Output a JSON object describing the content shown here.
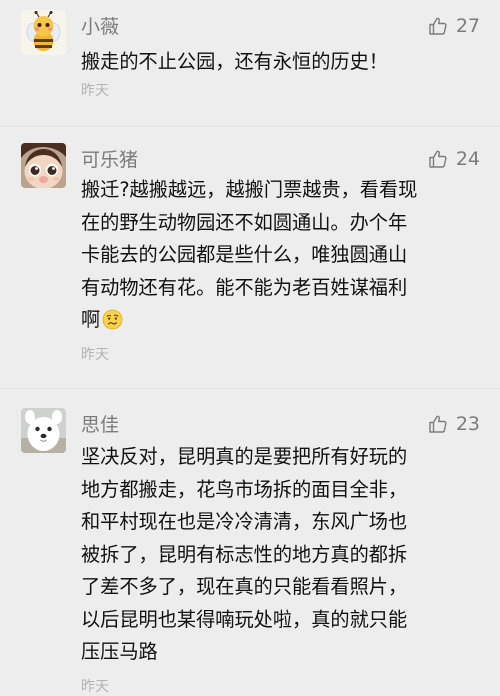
{
  "comments": [
    {
      "avatar_icon": "cartoon-bee-avatar-icon",
      "name": "小薇",
      "likes": "27",
      "content": "搬走的不止公园，还有永恒的历史！",
      "time": "昨天"
    },
    {
      "avatar_icon": "doll-face-avatar-icon",
      "name": "可乐猪",
      "likes": "24",
      "content": "搬迁?越搬越远，越搬门票越贵，看看现\n在的野生动物园还不如圆通山。办个年\n卡能去的公园都是些什么，唯独圆通山\n有动物还有花。能不能为老百姓谋福利\n啊",
      "emoji": "confused-face-emoji",
      "time": "昨天"
    },
    {
      "avatar_icon": "white-puppy-avatar-icon",
      "name": "思佳",
      "likes": "23",
      "content": "坚决反对，昆明真的是要把所有好玩的\n地方都搬走，花鸟市场拆的面目全非，\n和平村现在也是冷冷清清，东风广场也\n被拆了，昆明有标志性的地方真的都拆\n了差不多了，现在真的只能看看照片，\n以后昆明也某得喃玩处啦，真的就只能\n压压马路",
      "time": "昨天"
    }
  ],
  "colors": {
    "background": "#ededed",
    "name_text": "#7c7c7c",
    "body_text": "#111111",
    "time_text": "#b4b4b4",
    "like_icon": "#7c7c7c"
  }
}
